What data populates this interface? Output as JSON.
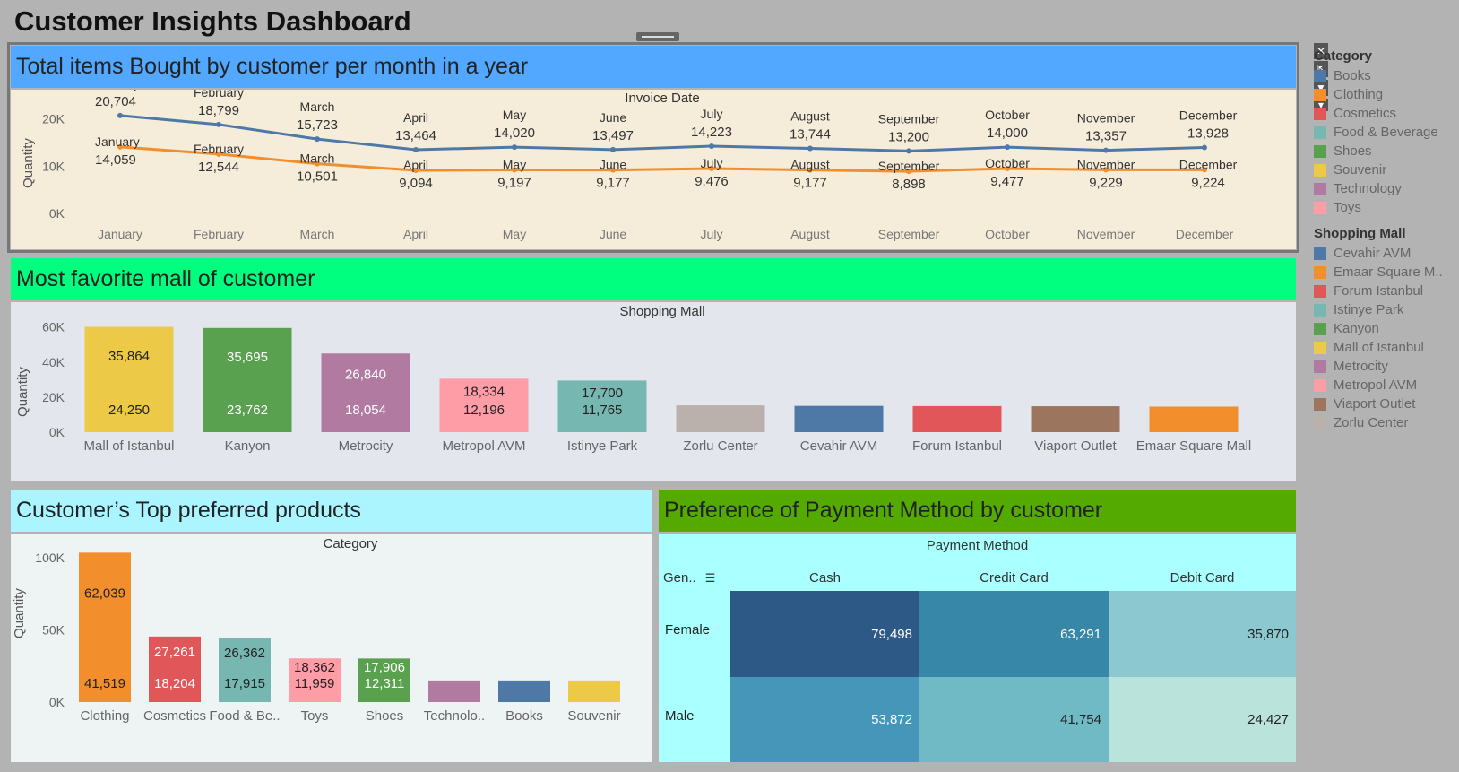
{
  "dashboard": {
    "title": "Customer Insights Dashboard"
  },
  "toolbar": {
    "close_glyph": "✕",
    "popout_glyph": "⇱",
    "filter_glyph": "▼",
    "more_glyph": "▾"
  },
  "line_panel": {
    "title": "Total items Bought by customer per month in a year",
    "header": "Invoice Date",
    "ylabel": "Quantity",
    "yticks": [
      "20K",
      "10K",
      "0K"
    ],
    "months": [
      "January",
      "February",
      "March",
      "April",
      "May",
      "June",
      "July",
      "August",
      "September",
      "October",
      "November",
      "December"
    ]
  },
  "mall_panel": {
    "title": "Most favorite mall of customer",
    "header": "Shopping Mall",
    "ylabel": "Quantity",
    "yticks": [
      "60K",
      "40K",
      "20K",
      "0K"
    ]
  },
  "product_panel": {
    "title": "Customer’s Top preferred products",
    "header": "Category",
    "ylabel": "Quantity",
    "yticks": [
      "100K",
      "50K",
      "0K"
    ]
  },
  "payment_panel": {
    "title": "Preference of Payment Method by customer",
    "header": "Payment Method",
    "row_header": "Gen..",
    "columns": [
      "Cash",
      "Credit Card",
      "Debit Card"
    ],
    "rows": [
      {
        "label": "Female",
        "values": [
          "79,498",
          "63,291",
          "35,870"
        ]
      },
      {
        "label": "Male",
        "values": [
          "53,872",
          "41,754",
          "24,427"
        ]
      }
    ]
  },
  "legend": {
    "category": {
      "title": "Category",
      "items": [
        {
          "label": "Books",
          "color": "#4e79a7"
        },
        {
          "label": "Clothing",
          "color": "#f28e2b"
        },
        {
          "label": "Cosmetics",
          "color": "#e15759"
        },
        {
          "label": "Food & Beverage",
          "color": "#76b7b2"
        },
        {
          "label": "Shoes",
          "color": "#59a14f"
        },
        {
          "label": "Souvenir",
          "color": "#edc948"
        },
        {
          "label": "Technology",
          "color": "#b07aa1"
        },
        {
          "label": "Toys",
          "color": "#ff9da7"
        }
      ]
    },
    "mall": {
      "title": "Shopping Mall",
      "items": [
        {
          "label": "Cevahir AVM",
          "color": "#4e79a7"
        },
        {
          "label": "Emaar Square M..",
          "color": "#f28e2b"
        },
        {
          "label": "Forum Istanbul",
          "color": "#e15759"
        },
        {
          "label": "Istinye Park",
          "color": "#76b7b2"
        },
        {
          "label": "Kanyon",
          "color": "#59a14f"
        },
        {
          "label": "Mall of Istanbul",
          "color": "#edc948"
        },
        {
          "label": "Metrocity",
          "color": "#b07aa1"
        },
        {
          "label": "Metropol AVM",
          "color": "#ff9da7"
        },
        {
          "label": "Viaport Outlet",
          "color": "#9c755f"
        },
        {
          "label": "Zorlu Center",
          "color": "#bab0ac"
        }
      ]
    }
  },
  "colors": {
    "line_title_bg": "#52a8ff",
    "mall_title_bg": "#00ff7f",
    "product_title_bg": "#aaf5ff",
    "payment_title_bg": "#55aa00",
    "line_bg": "#f5ecd9",
    "mall_bg": "#e4e6ee",
    "product_bg": "#eef3f3",
    "payment_bg": "#aaffff",
    "series_top": "#4e79a7",
    "series_bottom": "#f28e2b"
  },
  "chart_data": [
    {
      "type": "line",
      "title": "Total items Bought by customer per month in a year",
      "xlabel": "Invoice Date",
      "ylabel": "Quantity",
      "x": [
        "January",
        "February",
        "March",
        "April",
        "May",
        "June",
        "July",
        "August",
        "September",
        "October",
        "November",
        "December"
      ],
      "ylim": [
        0,
        22000
      ],
      "series": [
        {
          "values": [
            20704,
            18799,
            15723,
            13464,
            14020,
            13497,
            14223,
            13744,
            13200,
            14000,
            13357,
            13928
          ],
          "labels": [
            "20,704",
            "18,799",
            "15,723",
            "13,464",
            "14,020",
            "13,497",
            "14,223",
            "13,744",
            "13,200",
            "14,000",
            "13,357",
            "13,928"
          ]
        },
        {
          "values": [
            14059,
            12544,
            10501,
            9094,
            9197,
            9177,
            9476,
            9177,
            8898,
            9477,
            9229,
            9224
          ],
          "labels": [
            "14,059",
            "12,544",
            "10,501",
            "9,094",
            "9,197",
            "9,177",
            "9,476",
            "9,177",
            "8,898",
            "9,477",
            "9,229",
            "9,224"
          ]
        }
      ]
    },
    {
      "type": "bar",
      "title": "Most favorite mall of customer",
      "xlabel": "Shopping Mall",
      "ylabel": "Quantity",
      "ylim": [
        0,
        66000
      ],
      "categories": [
        "Mall of Istanbul",
        "Kanyon",
        "Metrocity",
        "Metropol AVM",
        "Istinye Park",
        "Zorlu Center",
        "Cevahir AVM",
        "Forum Istanbul",
        "Viaport Outlet",
        "Emaar Square Mall"
      ],
      "values": [
        60114,
        59457,
        44894,
        30530,
        29465,
        15300,
        15000,
        14900,
        14800,
        14600
      ],
      "label_top": [
        "35,864",
        "35,695",
        "26,840",
        "18,334",
        "17,700",
        "",
        "",
        "",
        "",
        ""
      ],
      "label_bottom": [
        "24,250",
        "23,762",
        "18,054",
        "12,196",
        "11,765",
        "",
        "",
        "",
        "",
        ""
      ],
      "colors": [
        "#edc948",
        "#59a14f",
        "#b07aa1",
        "#ff9da7",
        "#76b7b2",
        "#bab0ac",
        "#4e79a7",
        "#e15759",
        "#9c755f",
        "#f28e2b"
      ]
    },
    {
      "type": "bar",
      "title": "Customer’s Top preferred products",
      "xlabel": "Category",
      "ylabel": "Quantity",
      "ylim": [
        0,
        110000
      ],
      "categories": [
        "Clothing",
        "Cosmetics",
        "Food & Be..",
        "Toys",
        "Shoes",
        "Technolo..",
        "Books",
        "Souvenir"
      ],
      "values": [
        103558,
        45465,
        44277,
        30321,
        30217,
        15000,
        15000,
        15000
      ],
      "label_top": [
        "62,039",
        "27,261",
        "26,362",
        "18,362",
        "17,906",
        "",
        "",
        ""
      ],
      "label_bottom": [
        "41,519",
        "18,204",
        "17,915",
        "11,959",
        "12,311",
        "",
        "",
        ""
      ],
      "label_colors": [
        "#222",
        "#fff",
        "#222",
        "#222",
        "#fff",
        "",
        "",
        ""
      ],
      "colors": [
        "#f28e2b",
        "#e15759",
        "#76b7b2",
        "#ff9da7",
        "#59a14f",
        "#b07aa1",
        "#4e79a7",
        "#edc948"
      ]
    },
    {
      "type": "heatmap",
      "title": "Preference of Payment Method by customer",
      "x": [
        "Cash",
        "Credit Card",
        "Debit Card"
      ],
      "y": [
        "Female",
        "Male"
      ],
      "values": [
        [
          79498,
          63291,
          35870
        ],
        [
          53872,
          41754,
          24427
        ]
      ],
      "colors": [
        [
          "#2c5985",
          "#3787a8",
          "#8cc8cf"
        ],
        [
          "#4596b8",
          "#70bac6",
          "#b9e3db"
        ]
      ],
      "text_colors": [
        [
          "#fff",
          "#fff",
          "#222"
        ],
        [
          "#fff",
          "#222",
          "#222"
        ]
      ]
    }
  ]
}
